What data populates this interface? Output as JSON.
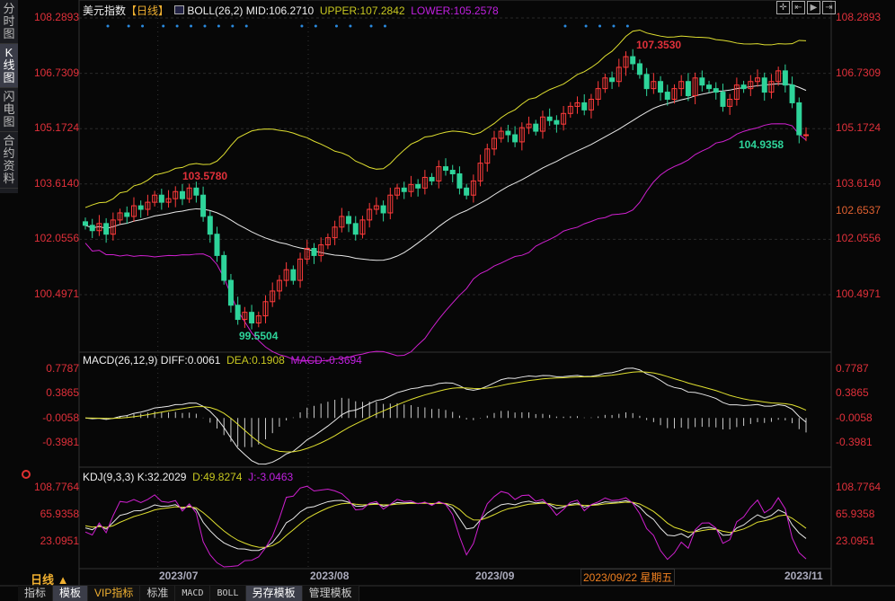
{
  "sidebar": [
    "分时图",
    "K线图",
    "闪电图",
    "合约资料"
  ],
  "title": {
    "name": "美元指数",
    "period": "【日线】",
    "boll": "BOLL(26,2)",
    "mid": "MID:106.2710",
    "upper": "UPPER:107.2842",
    "lower": "LOWER:105.2578"
  },
  "price_axis": [
    "108.2893",
    "106.7309",
    "105.1724",
    "103.6140",
    "102.0556",
    "100.4971"
  ],
  "price_values": [
    108.2893,
    106.7309,
    105.1724,
    103.614,
    102.0556,
    100.4971
  ],
  "current_price": "102.6537",
  "annotations": {
    "high1": "103.5780",
    "low1": "99.5504",
    "high2": "107.3530",
    "low2": "104.9358"
  },
  "macd": {
    "label": "MACD(26,12,9)",
    "diff": "DIFF:0.0061",
    "dea": "DEA:0.1908",
    "macd": "MACD:-0.3694",
    "axis": [
      "0.7787",
      "0.3865",
      "-0.0058",
      "-0.3981"
    ],
    "values": [
      0.7787,
      0.3865,
      -0.0058,
      -0.3981
    ]
  },
  "kdj": {
    "label": "KDJ(9,3,3)",
    "k": "K:32.2029",
    "d": "D:49.8274",
    "j": "J:-3.0463",
    "axis": [
      "108.7764",
      "65.9358",
      "23.0951"
    ],
    "values": [
      108.7764,
      65.9358,
      23.0951
    ]
  },
  "dates": [
    "2023/07",
    "2023/08",
    "2023/09",
    "2023/11"
  ],
  "cursor_date": "2023/09/22 星期五",
  "period_label": "日线 ▲",
  "tabs": [
    "指标",
    "模板",
    "VIP指标",
    "标准",
    "MACD",
    "BOLL",
    "另存模板",
    "管理模板"
  ],
  "colors": {
    "up": "#ff3b3b",
    "down": "#2ed49a",
    "mid": "#e8e8e8",
    "upper": "#e0e030",
    "lower": "#d020d0"
  },
  "chart_data": {
    "type": "candlestick",
    "closes": [
      102.45,
      102.3,
      102.5,
      102.2,
      102.6,
      102.8,
      102.7,
      103.0,
      102.9,
      103.1,
      103.3,
      103.1,
      103.2,
      103.4,
      103.2,
      103.5,
      103.3,
      102.7,
      102.2,
      101.6,
      100.9,
      100.2,
      99.8,
      100.0,
      99.7,
      99.9,
      100.3,
      100.6,
      100.9,
      101.2,
      100.9,
      101.5,
      101.8,
      101.6,
      101.9,
      102.1,
      102.4,
      102.7,
      102.5,
      102.2,
      102.6,
      102.9,
      103.0,
      102.8,
      103.3,
      103.5,
      103.4,
      103.6,
      103.5,
      103.8,
      103.7,
      104.1,
      104.0,
      103.9,
      103.5,
      103.3,
      103.7,
      104.2,
      104.6,
      104.9,
      105.1,
      105.0,
      104.8,
      105.2,
      105.3,
      105.1,
      105.5,
      105.4,
      105.3,
      105.6,
      105.8,
      105.9,
      105.7,
      106.0,
      106.3,
      106.6,
      106.5,
      106.9,
      107.2,
      107.0,
      106.7,
      106.3,
      106.5,
      106.2,
      106.0,
      106.3,
      106.5,
      106.1,
      106.6,
      106.4,
      106.3,
      106.2,
      105.8,
      106.0,
      106.4,
      106.3,
      106.5,
      106.6,
      106.2,
      106.5,
      106.8,
      106.4,
      105.9,
      105.0,
      105.0
    ]
  }
}
